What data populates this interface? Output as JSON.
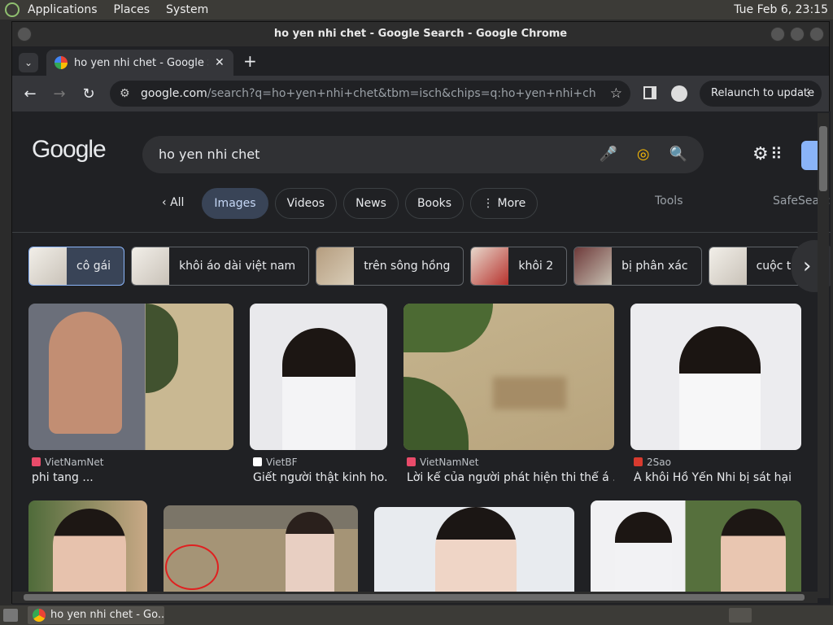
{
  "topbar": {
    "applications": "Applications",
    "places": "Places",
    "system": "System",
    "clock": "Tue Feb  6, 23:15"
  },
  "window": {
    "title": "ho yen nhi chet - Google Search - Google Chrome"
  },
  "tab": {
    "label": "ho yen nhi chet - Google Search",
    "close": "✕",
    "new": "+"
  },
  "toolbar": {
    "url_host": "google.com",
    "url_path": "/search?q=ho+yen+nhi+chet&tbm=isch&chips=q:ho+yen+nhi+chet,online_c...",
    "relaunch": "Relaunch to update"
  },
  "search": {
    "logo": "Google",
    "query": "ho yen nhi chet"
  },
  "filters": {
    "all": "All",
    "images": "Images",
    "videos": "Videos",
    "news": "News",
    "books": "Books",
    "more": "More",
    "tools": "Tools",
    "safesearch": "SafeSearch"
  },
  "chips": [
    {
      "label": "cô gái"
    },
    {
      "label": "khôi áo dài việt nam"
    },
    {
      "label": "trên sông hồng"
    },
    {
      "label": "khôi 2"
    },
    {
      "label": "bị phân xác"
    },
    {
      "label": "cuộc thi"
    }
  ],
  "results": [
    {
      "source": "VietNamNet",
      "caption": "phi tang ..."
    },
    {
      "source": "VietBF",
      "caption": "Giết người thật kinh ho..."
    },
    {
      "source": "VietNamNet",
      "caption": "Lời kể của người phát hiện thi thể á ..."
    },
    {
      "source": "2Sao",
      "caption": "Á khôi Hồ Yến Nhi bị sát hại"
    }
  ],
  "taskbar": {
    "task": "ho yen nhi chet - Go..."
  }
}
